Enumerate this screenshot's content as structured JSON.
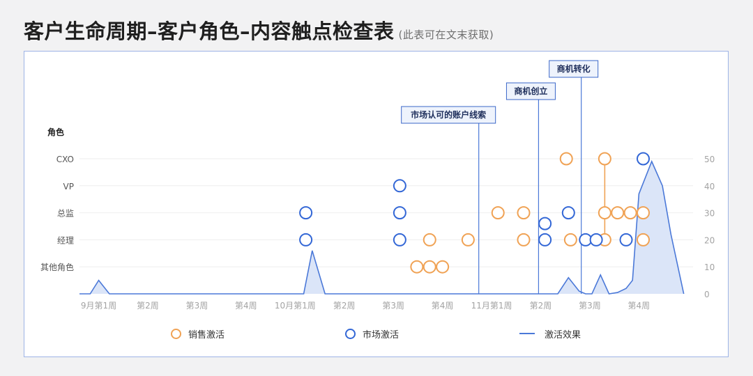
{
  "header": {
    "title": "客户生命周期–客户角色–内容触点检查表",
    "subtitle": "(此表可在文末获取)"
  },
  "colors": {
    "orange": "#f0a254",
    "blue": "#3367d6",
    "line": "#4a78d8",
    "area": "#dbe5f8",
    "grid": "#eeeeee",
    "tick": "#a3a3a3",
    "label": "#555555"
  },
  "chart_data": {
    "type": "scatter",
    "y_title": "角色",
    "roles": [
      "CXO",
      "VP",
      "总监",
      "经理",
      "其他角色"
    ],
    "x_ticks": [
      "9月第1周",
      "第2周",
      "第3周",
      "第4周",
      "10月第1周",
      "第2周",
      "第3周",
      "第4周",
      "11月第1周",
      "第2周",
      "第3周",
      "第4周"
    ],
    "right_axis": {
      "ticks": [
        0,
        10,
        20,
        30,
        40,
        50
      ],
      "ylim": [
        0,
        50
      ]
    },
    "milestones": [
      {
        "label": "市场认可的账户线索",
        "x": 9.35
      },
      {
        "label": "商机创立",
        "x": 10.75
      },
      {
        "label": "商机转化",
        "x": 11.75
      }
    ],
    "series": [
      {
        "name": "销售激活",
        "points": [
          {
            "x": 7.9,
            "y": 10
          },
          {
            "x": 8.2,
            "y": 10
          },
          {
            "x": 8.5,
            "y": 10
          },
          {
            "x": 8.2,
            "y": 20
          },
          {
            "x": 9.1,
            "y": 20
          },
          {
            "x": 9.8,
            "y": 30
          },
          {
            "x": 10.4,
            "y": 30
          },
          {
            "x": 10.4,
            "y": 20
          },
          {
            "x": 11.4,
            "y": 50
          },
          {
            "x": 11.5,
            "y": 20
          },
          {
            "x": 12.3,
            "y": 50
          },
          {
            "x": 12.3,
            "y": 30
          },
          {
            "x": 12.3,
            "y": 20
          },
          {
            "x": 12.6,
            "y": 30
          },
          {
            "x": 12.9,
            "y": 30
          },
          {
            "x": 13.2,
            "y": 30
          },
          {
            "x": 13.2,
            "y": 20
          }
        ]
      },
      {
        "name": "市场激活",
        "points": [
          {
            "x": 5.3,
            "y": 30
          },
          {
            "x": 5.3,
            "y": 20
          },
          {
            "x": 7.5,
            "y": 40
          },
          {
            "x": 7.5,
            "y": 30
          },
          {
            "x": 7.5,
            "y": 20
          },
          {
            "x": 10.9,
            "y": 26
          },
          {
            "x": 10.9,
            "y": 20
          },
          {
            "x": 11.45,
            "y": 30
          },
          {
            "x": 11.85,
            "y": 20
          },
          {
            "x": 12.1,
            "y": 20
          },
          {
            "x": 12.8,
            "y": 20
          },
          {
            "x": 13.2,
            "y": 50
          }
        ]
      },
      {
        "name": "激活效果",
        "points": [
          [
            0,
            0
          ],
          [
            0.25,
            0
          ],
          [
            0.45,
            5
          ],
          [
            0.7,
            0
          ],
          [
            5.25,
            0
          ],
          [
            5.45,
            16
          ],
          [
            5.75,
            0
          ],
          [
            11.2,
            0
          ],
          [
            11.45,
            6
          ],
          [
            11.7,
            1
          ],
          [
            11.85,
            0
          ],
          [
            12.0,
            0
          ],
          [
            12.2,
            7
          ],
          [
            12.4,
            0
          ],
          [
            12.6,
            0.5
          ],
          [
            12.8,
            2
          ],
          [
            12.95,
            5
          ],
          [
            13.1,
            37
          ],
          [
            13.4,
            49
          ],
          [
            13.65,
            40
          ],
          [
            13.85,
            22
          ],
          [
            14.0,
            11
          ],
          [
            14.15,
            0
          ]
        ]
      }
    ],
    "connectors": [
      {
        "x": 12.3,
        "y1": 50,
        "y2": 20
      }
    ]
  }
}
